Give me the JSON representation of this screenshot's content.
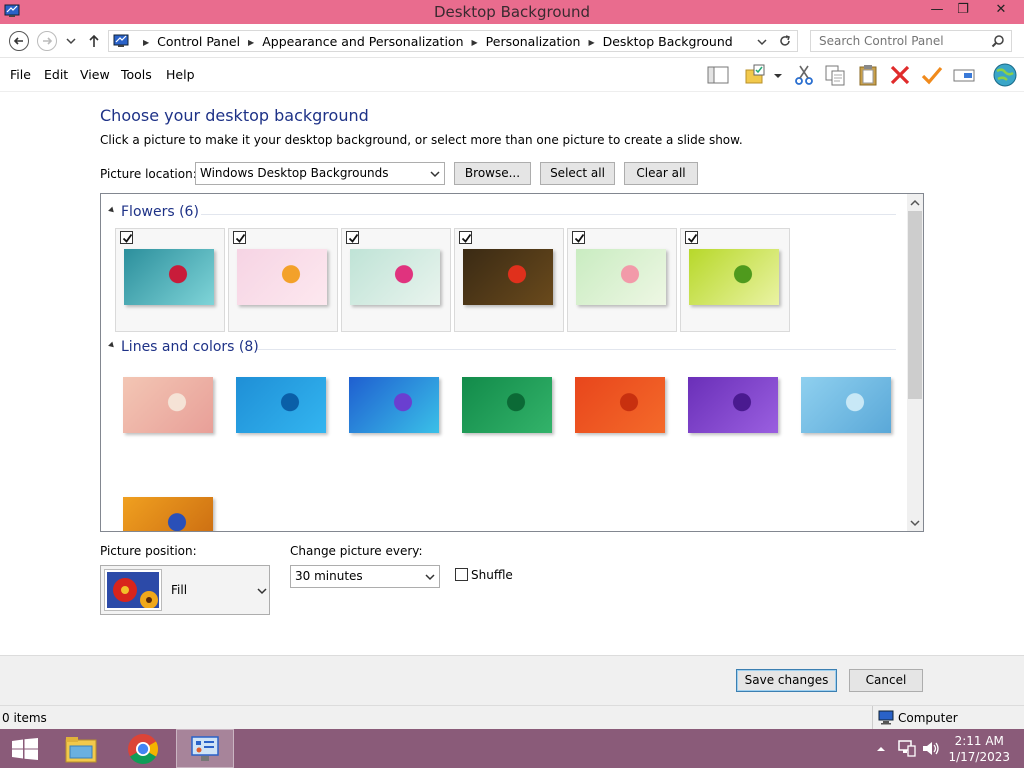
{
  "window": {
    "title": "Desktop Background",
    "controls": {
      "minimize": "—",
      "restore": "❐",
      "close": "✕"
    }
  },
  "address_bar": {
    "breadcrumbs": [
      "Control Panel",
      "Appearance and Personalization",
      "Personalization",
      "Desktop Background"
    ],
    "search_placeholder": "Search Control Panel"
  },
  "menu": {
    "items": [
      "File",
      "Edit",
      "View",
      "Tools",
      "Help"
    ]
  },
  "toolbar": {
    "icons": [
      "layout-pane-icon",
      "folder-properties-icon",
      "cut-icon",
      "copy-icon",
      "paste-icon",
      "delete-icon",
      "checkmark-icon",
      "rename-icon",
      "globe-icon"
    ]
  },
  "main": {
    "heading": "Choose your desktop background",
    "instructions": "Click a picture to make it your desktop background, or select more than one picture to create a slide show.",
    "location_label": "Picture location:",
    "location_value": "Windows Desktop Backgrounds",
    "browse_label": "Browse...",
    "select_all_label": "Select all",
    "clear_all_label": "Clear all"
  },
  "gallery": {
    "groups": [
      {
        "name": "Flowers (6)",
        "items": [
          {
            "checked": true,
            "colors": [
              "#2c8f9c",
              "#7fd4d8",
              "#c81c3a"
            ]
          },
          {
            "checked": true,
            "colors": [
              "#f6d4e4",
              "#fde8ef",
              "#f3a12a"
            ]
          },
          {
            "checked": true,
            "colors": [
              "#bfe3d6",
              "#e9f4ee",
              "#e0337e"
            ]
          },
          {
            "checked": true,
            "colors": [
              "#3a2a14",
              "#6a4a1c",
              "#e0301c"
            ]
          },
          {
            "checked": true,
            "colors": [
              "#c9ecc1",
              "#eef7e4",
              "#f29aa9"
            ]
          },
          {
            "checked": true,
            "colors": [
              "#b7d82a",
              "#eaf3a3",
              "#4f9a1d"
            ]
          }
        ]
      },
      {
        "name": "Lines and colors (8)",
        "items": [
          {
            "checked": false,
            "colors": [
              "#f3c6b4",
              "#e89f98",
              "#f5e3d6"
            ]
          },
          {
            "checked": false,
            "colors": [
              "#1f8fd6",
              "#33b5f0",
              "#0a5fa8"
            ]
          },
          {
            "checked": false,
            "colors": [
              "#1f5fd0",
              "#3ac0e8",
              "#6a3fd0"
            ]
          },
          {
            "checked": false,
            "colors": [
              "#128b4a",
              "#33b36a",
              "#0b6a36"
            ]
          },
          {
            "checked": false,
            "colors": [
              "#e8461c",
              "#f46a2a",
              "#c8300f"
            ]
          },
          {
            "checked": false,
            "colors": [
              "#6a2fb8",
              "#9a5fe0",
              "#4a1a90"
            ]
          },
          {
            "checked": false,
            "colors": [
              "#8fd0ef",
              "#5aa8d8",
              "#c8e8f6"
            ]
          },
          {
            "checked": false,
            "colors": [
              "#f0a020",
              "#c86810",
              "#2a50b8"
            ]
          }
        ]
      }
    ]
  },
  "settings": {
    "position_label": "Picture position:",
    "position_value": "Fill",
    "interval_label": "Change picture every:",
    "interval_value": "30 minutes",
    "shuffle_label": "Shuffle",
    "shuffle_checked": false
  },
  "footer": {
    "save_label": "Save changes",
    "cancel_label": "Cancel"
  },
  "status": {
    "items_text": "0 items",
    "location_text": "Computer"
  },
  "taskbar": {
    "time": "2:11 AM",
    "date": "1/17/2023"
  },
  "colors": {
    "title_bar": "#e96c8e",
    "taskbar": "#8a5b79",
    "heading": "#1e3287"
  }
}
